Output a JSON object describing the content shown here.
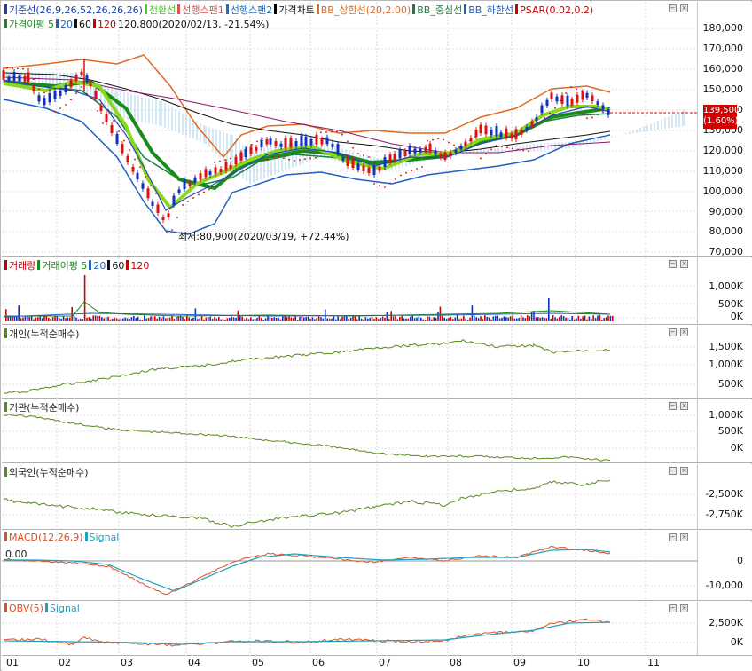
{
  "main": {
    "legend": [
      {
        "label": "기준선(26,9,26,52,26,26,26)",
        "color": "#1a3fb0"
      },
      {
        "label": "전환선",
        "color": "#46c828"
      },
      {
        "label": "선행스팬1",
        "color": "#e05050"
      },
      {
        "label": "선행스팬2",
        "color": "#2070c0"
      },
      {
        "label": "가격차트",
        "color": "#000000"
      },
      {
        "label": "BB_상한선(20,2.00)",
        "color": "#e06a20"
      },
      {
        "label": "BB_중심선",
        "color": "#1a8040"
      },
      {
        "label": "BB_하한선",
        "color": "#2060c0"
      },
      {
        "label": "PSAR(0.02,0.2)",
        "color": "#d00000"
      }
    ],
    "legend2": [
      {
        "label": "가격이평 5",
        "color": "#1a8a1a"
      },
      {
        "label": "20",
        "color": "#2060c0"
      },
      {
        "label": "60",
        "color": "#111111"
      },
      {
        "label": "120",
        "color": "#c00000"
      }
    ],
    "high_note": "120,800(2020/02/13, -21.54%)",
    "low_note": "최저:80,900(2020/03/19, +72.44%)",
    "price_label": "139,500",
    "change_label": "(1.60%)",
    "y_ticks": [
      "180,000",
      "170,000",
      "160,000",
      "150,000",
      "140,000",
      "130,000",
      "120,000",
      "110,000",
      "100,000",
      "90,000",
      "80,000",
      "70,000"
    ]
  },
  "volume": {
    "legend": [
      {
        "label": "거래량",
        "color": "#c00000"
      },
      {
        "label": "거래이평 5",
        "color": "#1a8a1a"
      },
      {
        "label": "20",
        "color": "#2060c0"
      },
      {
        "label": "60",
        "color": "#111111"
      },
      {
        "label": "120",
        "color": "#c00000"
      }
    ],
    "y_ticks": [
      "1,000K",
      "500K",
      "0K"
    ]
  },
  "individual": {
    "legend": "개인(누적순매수)",
    "color": "#5a8a1a",
    "y_ticks": [
      "1,500K",
      "1,000K",
      "500K"
    ]
  },
  "institution": {
    "legend": "기관(누적순매수)",
    "color": "#5a8a1a",
    "y_ticks": [
      "1,000K",
      "500K",
      "0K"
    ]
  },
  "foreign": {
    "legend": "외국인(누적순매수)",
    "color": "#5a8a1a",
    "y_ticks": [
      "-2,500K",
      "-2,750K"
    ]
  },
  "macd": {
    "legend": [
      {
        "label": "MACD(12,26,9)",
        "color": "#e05020"
      },
      {
        "label": "Signal",
        "color": "#20a0c0"
      }
    ],
    "zero_label": "0.00",
    "y_ticks": [
      "0",
      "-10,000"
    ]
  },
  "obv": {
    "legend": [
      {
        "label": "OBV(5)",
        "color": "#e05020"
      },
      {
        "label": "Signal",
        "color": "#20a0c0"
      }
    ],
    "y_ticks": [
      "2,500K",
      "0K"
    ]
  },
  "x_axis": [
    "01",
    "02",
    "03",
    "04",
    "05",
    "06",
    "07",
    "08",
    "09",
    "10",
    "11"
  ]
}
